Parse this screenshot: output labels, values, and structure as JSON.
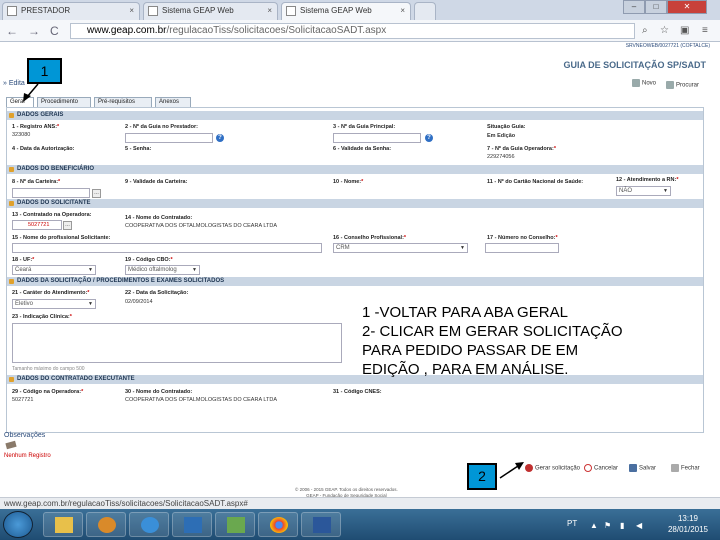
{
  "browser": {
    "tabs": [
      {
        "label": "PRESTADOR"
      },
      {
        "label": "Sistema GEAP Web"
      },
      {
        "label": "Sistema GEAP Web"
      }
    ],
    "url_domain": "www.geap.com.br",
    "url_path": "/regulacaoTiss/solicitacoes/SolicitacaoSADT.aspx",
    "status_url": "www.geap.com.br/regulacaoTiss/solicitacoes/SolicitacaoSADT.aspx#"
  },
  "header": {
    "sysinfo": "SRVNEOWEB/0027721 (COFTALCE)",
    "title": "GUIA DE SOLICITAÇÃO SP/SADT",
    "novo": "Novo",
    "procurar": "Procurar",
    "crumb": "» Edita"
  },
  "form_tabs": [
    "Geral",
    "Procedimento",
    "Pré-requisitos",
    "Anexos"
  ],
  "sections": {
    "dados_gerais": "DADOS GERAIS",
    "beneficiario": "DADOS DO BENEFICIÁRIO",
    "solicitante": "DADOS DO SOLICITANTE",
    "solicitacao": "DADOS DA SOLICITAÇÃO / PROCEDIMENTOS E EXAMES SOLICITADOS",
    "executante": "DADOS DO CONTRATADO EXECUTANTE"
  },
  "fields": {
    "f1": "1 - Registro ANS:",
    "f1_val": "323080",
    "f2": "2 - Nº da Guia no Prestador:",
    "f3": "3 - Nº da Guia Principal:",
    "situacao": "Situação Guia:",
    "situacao_val": "Em Edição",
    "f4": "4 - Data da Autorização:",
    "f5": "5 - Senha:",
    "f6": "6 - Validade da Senha:",
    "f7": "7 - Nº da Guia Operadora:",
    "f7_val": "229274056",
    "f8": "8 - Nº da Carteira:",
    "f9": "9 - Validade da Carteira:",
    "f10": "10 - Nome:",
    "f11": "11 - Nº do Cartão Nacional de Saúde:",
    "f12": "12 - Atendimento a RN:",
    "f12_val": "NÃO",
    "f13": "13 - Contratado na Operadora:",
    "f13_val": "5027721",
    "f14": "14 - Nome do Contratado:",
    "f14_val": "COOPERATIVA DOS OFTALMOLOGISTAS DO CEARA LTDA",
    "f15": "15 - Nome do profissional Solicitante:",
    "f16": "16 - Conselho Profissional:",
    "f16_val": "CRM",
    "f17": "17 - Número no Conselho:",
    "f18": "18 - UF:",
    "f18_val": "Ceará",
    "f19": "19 - Código CBO:",
    "f19_val": "Médico oftalmolog",
    "f21": "21 - Caráter do Atendimento:",
    "f21_val": "Eletivo",
    "f22": "22 - Data da Solicitação:",
    "f22_val": "02/09/2014",
    "f23": "23 - Indicação Clínica:",
    "f23_hint": "Tamanho máximo do campo 500",
    "f29": "29 - Código na Operadora:",
    "f29_val": "5027721",
    "f30": "30 - Nome do Contratado:",
    "f30_val": "COOPERATIVA DOS OFTALMOLOGISTAS DO CEARA LTDA",
    "f31": "31 - Código CNES:"
  },
  "footer": {
    "observacoes": "Observações",
    "nenhum": "Nenhum Registro",
    "gerar": "Gerar solicitação",
    "cancelar": "Cancelar",
    "salvar": "Salvar",
    "fechar": "Fechar",
    "copyright1": "© 2006 - 2015 GEAP. Todos os direitos reservados.",
    "copyright2": "GEAP - Fundação de Seguridade Social",
    "copyright3": "[Framework Web - 3.5.1] [RegulacaoTiss.dll - 1.3.1]"
  },
  "overlay": {
    "callout1": "1",
    "callout2": "2",
    "line1": "1 -VOLTAR PARA ABA GERAL",
    "line2": "2- CLICAR EM GERAR SOLICITAÇÃO",
    "line3": "PARA PEDIDO PASSAR DE EM",
    "line4": "EDIÇÃO , PARA EM ANÁLISE."
  },
  "taskbar": {
    "lang": "PT",
    "time": "13:19",
    "date": "28/01/2015"
  },
  "colors": {
    "section_bg": "#c9d5e3",
    "callout": "#0096d6",
    "required": "#cc0000"
  }
}
